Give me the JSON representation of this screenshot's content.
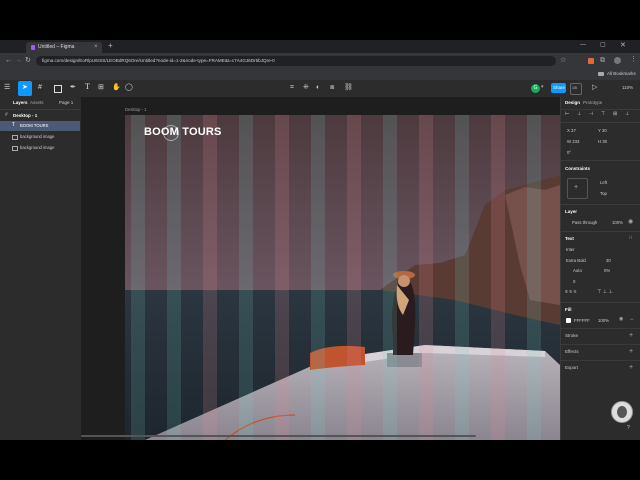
{
  "browser": {
    "tab_title": "Untitled – Figma",
    "url": "figma.com/design/EoRlpU6rSS/LEOBdRQ6Ore/Untitled?node-id=1-2&node-type=FRAME&t=c7A4GJ6Dr5bJQre-0",
    "bookmarks_label": "All Bookmarks"
  },
  "toolbar": {
    "share_label": "Share",
    "zoom_label": "110%",
    "avatar_letter": "G",
    "page_badge": "1/5"
  },
  "left_panel": {
    "tabs": [
      "Layers",
      "Assets"
    ],
    "page_label": "Page 1",
    "layers": [
      {
        "label": "Desktop - 1",
        "selected": false
      },
      {
        "label": "BOOM TOURS",
        "selected": true
      },
      {
        "label": "background image",
        "selected": false
      },
      {
        "label": "background image",
        "selected": false
      }
    ]
  },
  "canvas": {
    "frame_label": "Desktop - 1",
    "hero_title": "BOOM TOURS",
    "layout_columns": 12
  },
  "right_panel": {
    "tabs": [
      "Design",
      "Prototype"
    ],
    "x": "X 37",
    "y": "Y 30",
    "w": "W 233",
    "h": "H 30",
    "rotation": "0°",
    "constraints_title": "Constraints",
    "constraint_h": "Left",
    "constraint_v": "Top",
    "layer_title": "Layer",
    "blend_mode": "Pass through",
    "layer_opacity": "100%",
    "text_title": "Text",
    "font_family": "Inter",
    "font_weight": "Extra Bold",
    "font_size": "30",
    "line_height": "Auto",
    "letter_spacing": "0%",
    "paragraph_spacing": "0",
    "fill_title": "Fill",
    "fill_hex": "FFFFFF",
    "fill_opacity": "100%",
    "stroke_title": "Stroke",
    "effects_title": "Effects",
    "export_title": "Export",
    "help": "?"
  },
  "colors": {
    "accent": "#0d99ff",
    "panel": "#2c2c2c",
    "canvas": "#1e1e1e",
    "share": "#0d99ff",
    "avatar": "#14ae5c"
  }
}
